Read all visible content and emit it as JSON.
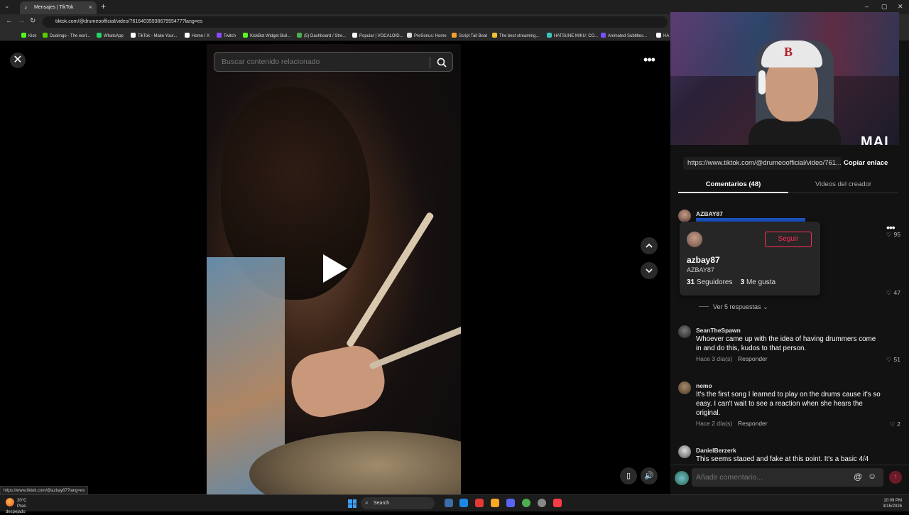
{
  "browser": {
    "tab_title": "Mensajes | TikTok",
    "url": "tiktok.com/@drumeoofficial/video/7616403593867955477?lang=es",
    "bookmarks": [
      {
        "label": "Kick",
        "color": "#53fc18"
      },
      {
        "label": "Duolingo - The worl...",
        "color": "#58cc02"
      },
      {
        "label": "WhatsApp",
        "color": "#25d366"
      },
      {
        "label": "TikTok - Make Your...",
        "color": "#ffffff"
      },
      {
        "label": "Home / X",
        "color": "#ffffff"
      },
      {
        "label": "Twitch",
        "color": "#9146ff"
      },
      {
        "label": "KickBot Widget Buil...",
        "color": "#53fc18"
      },
      {
        "label": "(5) Dashboard / Stre...",
        "color": "#4caf50"
      },
      {
        "label": "Popular | VOCALOID...",
        "color": "#ffffff"
      },
      {
        "label": "PreSonus: Home",
        "color": "#dddddd"
      },
      {
        "label": "Script Tail Beat",
        "color": "#f0a030"
      },
      {
        "label": "The best streaming...",
        "color": "#f0c030"
      },
      {
        "label": "HATSUNE MIKU: CO...",
        "color": "#39c5bb"
      },
      {
        "label": "Animated Subtitles...",
        "color": "#7c4dff"
      },
      {
        "label": "HA",
        "color": "#ffffff"
      }
    ]
  },
  "player": {
    "search_placeholder": "Buscar contenido relacionado",
    "status_url": "https://www.tiktok.com/@azbay87?lang=es"
  },
  "panel": {
    "share_url": "https://www.tiktok.com/@drumeoofficial/video/761...",
    "copy_label": "Copiar enlace",
    "tabs": [
      "Comentarios (48)",
      "Videos del creador"
    ],
    "stream_brand": "MAI"
  },
  "hovercard": {
    "follow_label": "Seguir",
    "name": "azbay87",
    "handle": "AZBAY87",
    "followers_count": "31",
    "followers_label": "Seguidores",
    "likes_count": "3",
    "likes_label": "Me gusta"
  },
  "comments": {
    "first": {
      "username": "AZBAY87",
      "likes": "95",
      "second_likes": "47",
      "replies_label": "Ver 5 respuestas"
    },
    "items": [
      {
        "username": "SeanTheSpawn",
        "text": "Whoever came up with the idea of having drummers come in and do this, kudos to that person.",
        "age": "Hace 3 día(s)",
        "reply": "Responder",
        "likes": "51"
      },
      {
        "username": "nemo",
        "text": "It's the first song I learned to play on the drums cause it's so easy. I can't wait to see a reaction when she hears the original.",
        "age": "Hace 2 día(s)",
        "reply": "Responder",
        "likes": "2"
      },
      {
        "username": "DanielBerzerk",
        "text": "This seems staged and fake at this point. It's a basic 4/4"
      }
    ],
    "input_placeholder": "Añadir comentario..."
  },
  "taskbar": {
    "temp": "20°C",
    "weather": "Prac. despejado",
    "search_label": "Search",
    "time": "10:09 PM",
    "date": "3/15/2026"
  },
  "colors": {
    "accent": "#fe2c55",
    "highlight": "#1b56c9"
  }
}
